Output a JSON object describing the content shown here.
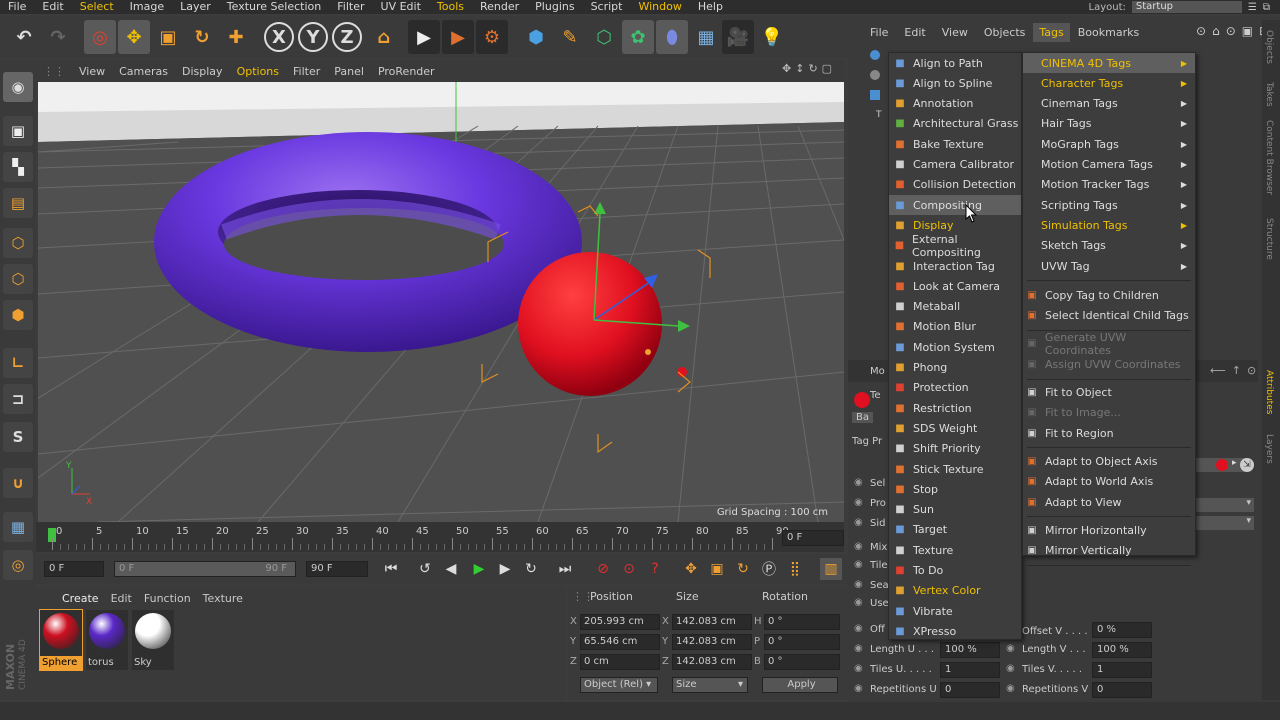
{
  "menubar": {
    "items": [
      "File",
      "Edit",
      "Select",
      "Image",
      "Layer",
      "Texture Selection",
      "Filter",
      "UV Edit",
      "Tools",
      "Render",
      "Plugins",
      "Script",
      "Window",
      "Help"
    ],
    "highlight": [
      "Select",
      "Tools",
      "Window"
    ],
    "layout_label": "Layout:",
    "layout_value": "Startup"
  },
  "viewport_menu": {
    "items": [
      "View",
      "Cameras",
      "Display",
      "Options",
      "Filter",
      "Panel",
      "ProRender"
    ],
    "highlight": "Options"
  },
  "viewport": {
    "grid_spacing": "Grid Spacing : 100 cm"
  },
  "timeline": {
    "ticks": [
      "0",
      "5",
      "10",
      "15",
      "20",
      "25",
      "30",
      "35",
      "40",
      "45",
      "50",
      "55",
      "60",
      "65",
      "70",
      "75",
      "80",
      "85",
      "90"
    ],
    "current_frame": "0 F"
  },
  "transport": {
    "start": "0 F",
    "range_start": "0 F",
    "range_end": "90 F",
    "end": "90 F"
  },
  "materials": {
    "menu": [
      "Create",
      "Edit",
      "Function",
      "Texture"
    ],
    "items": [
      {
        "name": "Sphere",
        "color": "#cc1020"
      },
      {
        "name": "torus",
        "color": "#5a28c8"
      },
      {
        "name": "Sky",
        "color": "#ffffff"
      }
    ]
  },
  "coords": {
    "headers": [
      "Position",
      "Size",
      "Rotation"
    ],
    "rows": [
      {
        "axis": "X",
        "pos": "205.993 cm",
        "size_axis": "X",
        "size": "142.083 cm",
        "rot_axis": "H",
        "rot": "0 °"
      },
      {
        "axis": "Y",
        "pos": "65.546 cm",
        "size_axis": "Y",
        "size": "142.083 cm",
        "rot_axis": "P",
        "rot": "0 °"
      },
      {
        "axis": "Z",
        "pos": "0 cm",
        "size_axis": "Z",
        "size": "142.083 cm",
        "rot_axis": "B",
        "rot": "0 °"
      }
    ],
    "mode": "Object (Rel)",
    "size_mode": "Size",
    "apply": "Apply"
  },
  "objects_menu": {
    "items": [
      "File",
      "Edit",
      "View",
      "Objects",
      "Tags",
      "Bookmarks"
    ],
    "active": "Tags"
  },
  "side_tabs": [
    "Objects",
    "Takes",
    "Content Browser",
    "Structure",
    "Attributes",
    "Layers"
  ],
  "attributes": {
    "partial_labels": [
      "Mo",
      "Te",
      "Ba",
      "Tag Pr",
      "Sel",
      "Pro",
      "Sid",
      "Mix",
      "Tile",
      "Sea",
      "Use",
      "Off"
    ],
    "rows": [
      {
        "l1": "Length U . . .",
        "v1": "100 %",
        "l2": "Length V . . .",
        "v2": "100 %"
      },
      {
        "l1": "Tiles U. . . . .",
        "v1": "1",
        "l2": "Tiles V. . . . .",
        "v2": "1"
      },
      {
        "l1": "Repetitions U",
        "v1": "0",
        "l2": "Repetitions V",
        "v2": "0"
      }
    ],
    "offset_v_label": "Offset V . . . .",
    "offset_v": "0 %"
  },
  "tags_menu": {
    "items": [
      {
        "label": "Align to Path",
        "icon": "path-icon",
        "color": "#6a9ad8"
      },
      {
        "label": "Align to Spline",
        "icon": "spline-icon",
        "color": "#6a9ad8"
      },
      {
        "label": "Annotation",
        "icon": "annotation-icon",
        "color": "#e0a030"
      },
      {
        "label": "Architectural Grass",
        "icon": "grass-icon",
        "color": "#60b040"
      },
      {
        "label": "Bake Texture",
        "icon": "bake-icon",
        "color": "#e07030"
      },
      {
        "label": "Camera Calibrator",
        "icon": "camera-icon",
        "color": "#d0d0d0"
      },
      {
        "label": "Collision Detection",
        "icon": "collision-icon",
        "color": "#e06030"
      },
      {
        "label": "Compositing",
        "icon": "compositing-icon",
        "color": "#6a9ad8"
      },
      {
        "label": "Display",
        "icon": "display-icon",
        "color": "#e0a030"
      },
      {
        "label": "External Compositing",
        "icon": "ext-compositing-icon",
        "color": "#e06030"
      },
      {
        "label": "Interaction Tag",
        "icon": "interaction-icon",
        "color": "#e0a030"
      },
      {
        "label": "Look at Camera",
        "icon": "look-icon",
        "color": "#e06030"
      },
      {
        "label": "Metaball",
        "icon": "metaball-icon",
        "color": "#d0d0d0"
      },
      {
        "label": "Motion Blur",
        "icon": "motion-blur-icon",
        "color": "#e07030"
      },
      {
        "label": "Motion System",
        "icon": "motion-system-icon",
        "color": "#6a9ad8"
      },
      {
        "label": "Phong",
        "icon": "phong-icon",
        "color": "#e0a030"
      },
      {
        "label": "Protection",
        "icon": "protection-icon",
        "color": "#e04030"
      },
      {
        "label": "Restriction",
        "icon": "restriction-icon",
        "color": "#e07030"
      },
      {
        "label": "SDS Weight",
        "icon": "sds-icon",
        "color": "#e0a030"
      },
      {
        "label": "Shift Priority",
        "icon": "priority-icon",
        "color": "#d0d0d0"
      },
      {
        "label": "Stick Texture",
        "icon": "stick-icon",
        "color": "#e07030"
      },
      {
        "label": "Stop",
        "icon": "stop-icon",
        "color": "#e07030"
      },
      {
        "label": "Sun",
        "icon": "sun-icon",
        "color": "#d0d0d0"
      },
      {
        "label": "Target",
        "icon": "target-icon",
        "color": "#6a9ad8"
      },
      {
        "label": "Texture",
        "icon": "texture-icon",
        "color": "#d0d0d0"
      },
      {
        "label": "To Do",
        "icon": "todo-icon",
        "color": "#e04030"
      },
      {
        "label": "Vertex Color",
        "icon": "vertex-color-icon",
        "color": "#e0a030"
      },
      {
        "label": "Vibrate",
        "icon": "vibrate-icon",
        "color": "#6a9ad8"
      },
      {
        "label": "XPresso",
        "icon": "xpresso-icon",
        "color": "#6a9ad8"
      }
    ],
    "highlighted": "Compositing",
    "yellow": [
      "Display",
      "Vertex Color"
    ]
  },
  "submenu": {
    "categories": [
      {
        "label": "CINEMA 4D Tags",
        "y": true,
        "hl": true
      },
      {
        "label": "Character Tags",
        "y": true
      },
      {
        "label": "Cineman Tags"
      },
      {
        "label": "Hair Tags"
      },
      {
        "label": "MoGraph Tags"
      },
      {
        "label": "Motion Camera Tags"
      },
      {
        "label": "Motion Tracker Tags"
      },
      {
        "label": "Scripting Tags"
      },
      {
        "label": "Simulation Tags",
        "y": true
      },
      {
        "label": "Sketch Tags"
      },
      {
        "label": "UVW Tag"
      }
    ],
    "actions1": [
      "Copy Tag to Children",
      "Select Identical Child Tags"
    ],
    "disabled": [
      "Generate UVW Coordinates",
      "Assign UVW Coordinates"
    ],
    "actions2": [
      {
        "label": "Fit to Object",
        "dis": false
      },
      {
        "label": "Fit to Image...",
        "dis": true
      },
      {
        "label": "Fit to Region",
        "dis": false
      }
    ],
    "actions3": [
      "Adapt to Object Axis",
      "Adapt to World Axis",
      "Adapt to View"
    ],
    "actions4": [
      "Mirror Horizontally",
      "Mirror Vertically"
    ]
  },
  "colors": {
    "accent": "#f0c000",
    "torus": "#5a28c8",
    "sphere": "#e01020"
  }
}
